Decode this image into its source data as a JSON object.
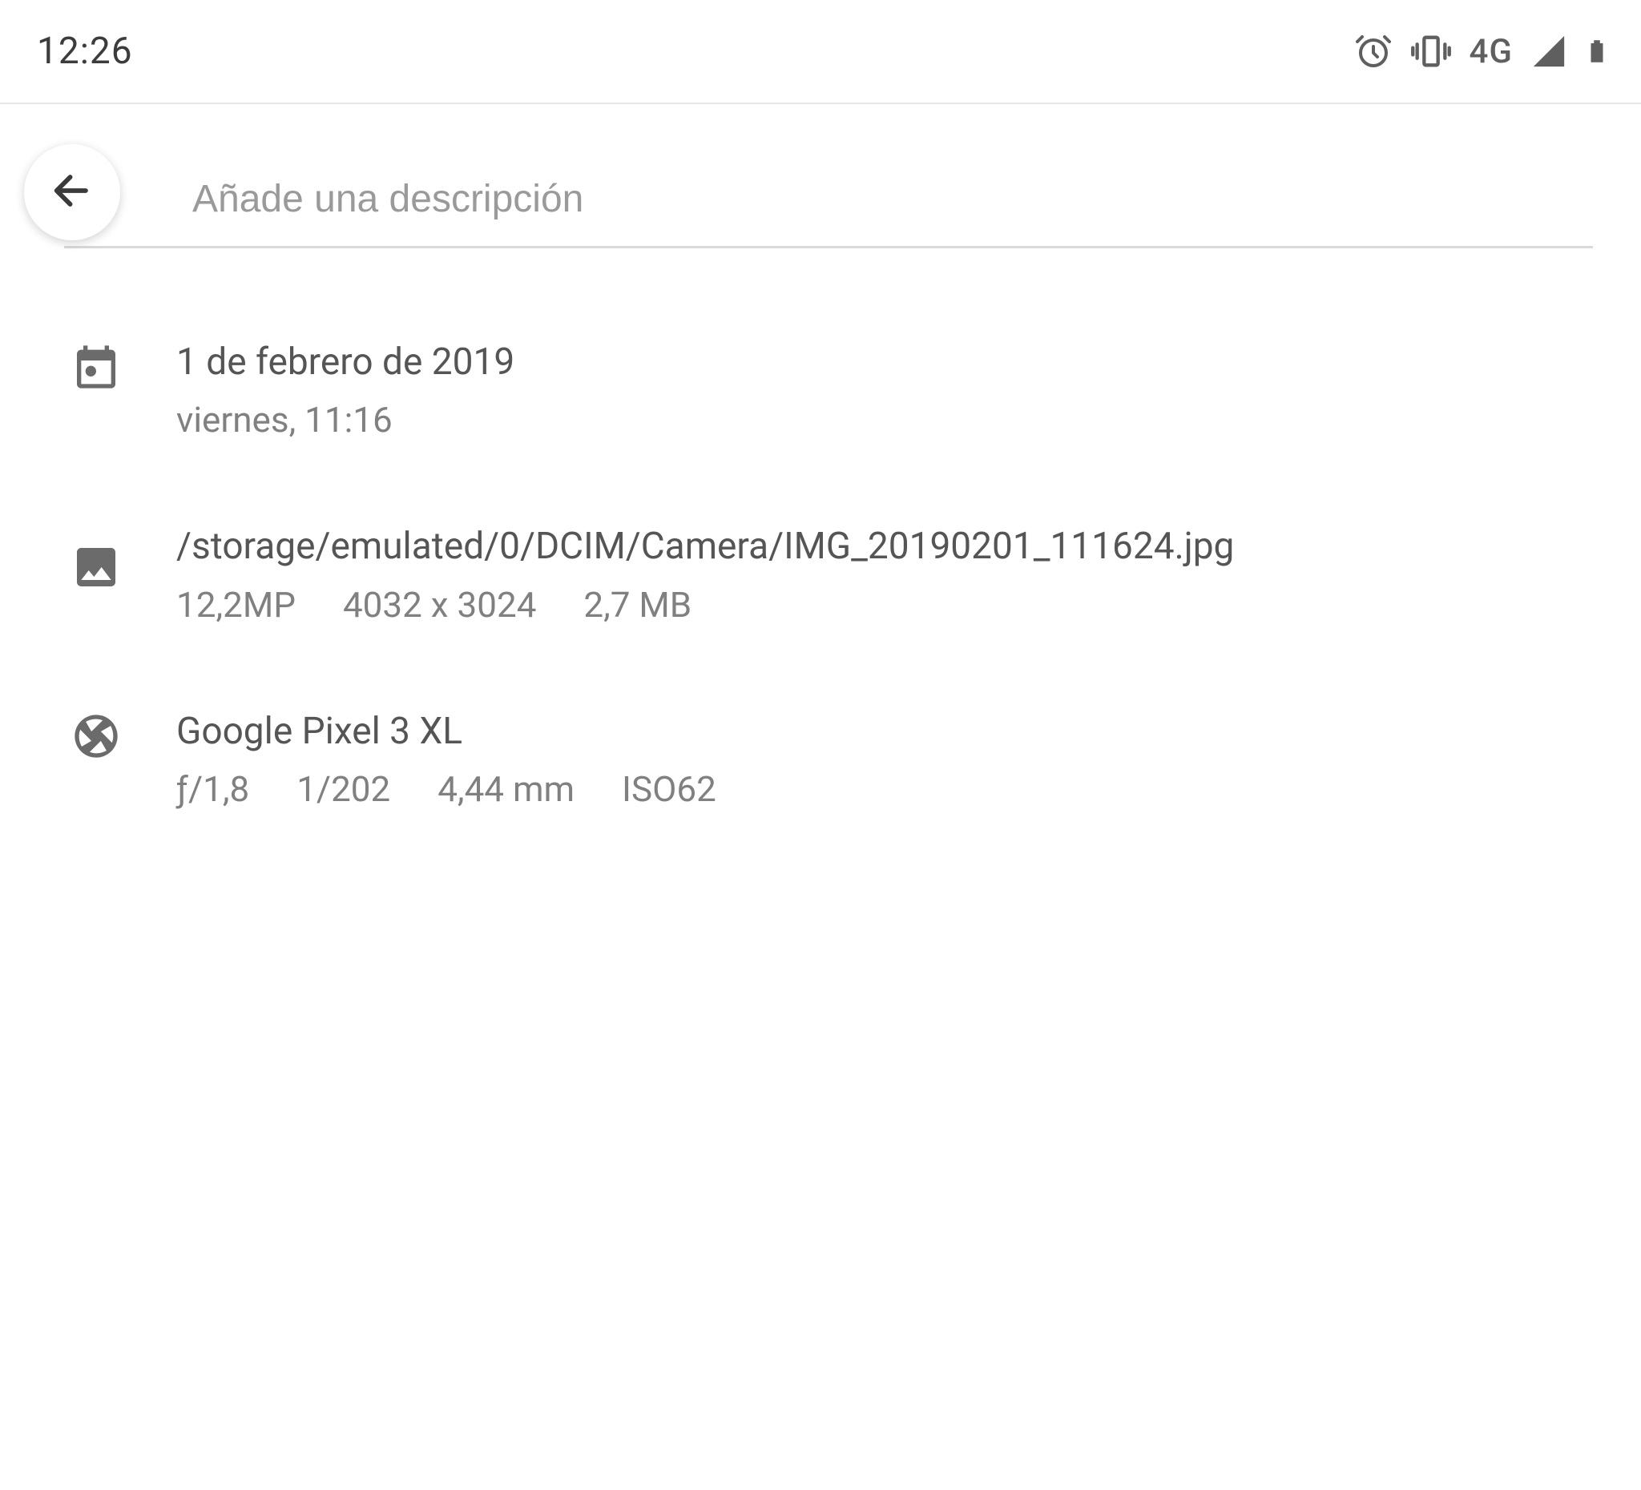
{
  "status": {
    "time": "12:26",
    "network_label": "4G"
  },
  "description": {
    "placeholder": "Añade una descripción"
  },
  "info": {
    "date": {
      "primary": "1 de febrero de 2019",
      "secondary": "viernes, 11:16"
    },
    "file": {
      "path": "/storage/emulated/0/DCIM/Camera/IMG_20190201_111624.jpg",
      "megapixels": "12,2MP",
      "dimensions": "4032 x 3024",
      "size": "2,7 MB"
    },
    "camera": {
      "device": "Google Pixel 3 XL",
      "aperture": "ƒ/1,8",
      "exposure": "1/202",
      "focal": "4,44 mm",
      "iso": "ISO62"
    }
  }
}
